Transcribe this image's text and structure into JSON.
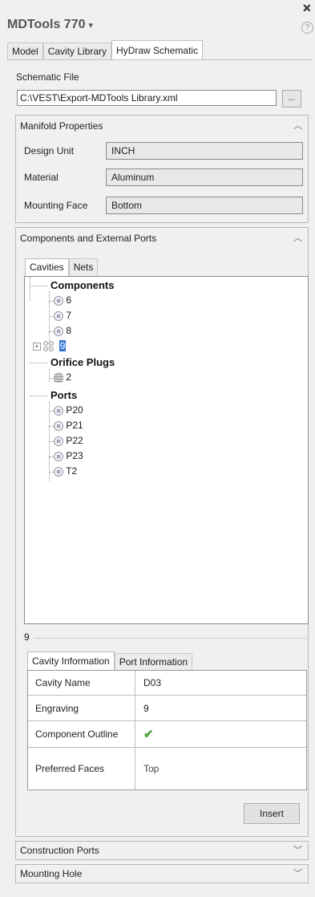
{
  "window": {
    "close_glyph": "✕",
    "help_glyph": "?",
    "app_title": "MDTools 770",
    "title_caret": "▾"
  },
  "top_tabs": [
    "Model",
    "Cavity Library",
    "HyDraw Schematic"
  ],
  "schematic": {
    "label": "Schematic File",
    "path": "C:\\VEST\\Export-MDTools Library.xml",
    "browse_label": "..."
  },
  "manifold": {
    "header": "Manifold Properties",
    "rows": [
      {
        "label": "Design Unit",
        "value": "INCH"
      },
      {
        "label": "Material",
        "value": "Aluminum"
      },
      {
        "label": "Mounting Face",
        "value": "Bottom"
      }
    ]
  },
  "components_panel": {
    "header": "Components and External Ports",
    "tabs": [
      "Cavities",
      "Nets"
    ],
    "tree": {
      "components_label": "Components",
      "components": [
        "6",
        "7",
        "8",
        "9"
      ],
      "selected": "9",
      "expander": "+",
      "orifice_label": "Orifice Plugs",
      "orifice": [
        "2"
      ],
      "ports_label": "Ports",
      "ports": [
        "P20",
        "P21",
        "P22",
        "P23",
        "T2"
      ]
    },
    "detail_title": "9",
    "detail_tabs": [
      "Cavity Information",
      "Port Information"
    ],
    "grid": [
      {
        "label": "Cavity Name",
        "value": "D03"
      },
      {
        "label": "Engraving",
        "value": "9"
      },
      {
        "label": "Component Outline",
        "value": "✔"
      },
      {
        "label": "Preferred Faces",
        "value": "Top"
      }
    ],
    "insert_label": "Insert"
  },
  "chevrons": {
    "up": "︿",
    "down": "﹀"
  },
  "collapsed_panels": [
    "Construction Ports",
    "Mounting Hole"
  ],
  "colors": {
    "selection": "#3375d6",
    "check": "#4aa03a"
  }
}
